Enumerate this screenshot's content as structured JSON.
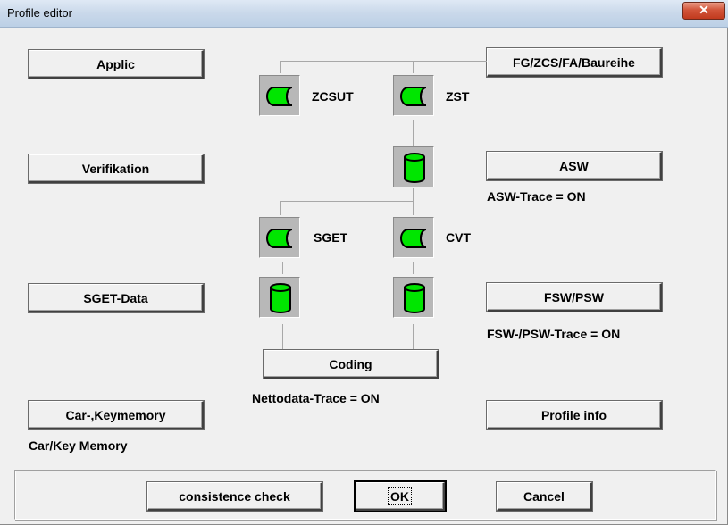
{
  "window": {
    "title": "Profile editor",
    "close_glyph": "✕"
  },
  "left_buttons": {
    "applic": "Applic",
    "verifikation": "Verifikation",
    "sget_data": "SGET-Data",
    "car_keymemory": "Car-,Keymemory"
  },
  "right_buttons": {
    "fg": "FG/ZCS/FA/Baureihe",
    "asw": "ASW",
    "fsw_psw": "FSW/PSW",
    "profile_info": "Profile info"
  },
  "center": {
    "coding": "Coding",
    "nodes": {
      "zcsut": "ZCSUT",
      "zst": "ZST",
      "sget": "SGET",
      "cvt": "CVT"
    }
  },
  "status": {
    "asw_trace": "ASW-Trace = ON",
    "fsw_psw_trace": "FSW-/PSW-Trace = ON",
    "nettodata_trace": "Nettodata-Trace = ON",
    "car_key_memory": "Car/Key Memory"
  },
  "footer": {
    "consistence_check": "consistence check",
    "ok": "OK",
    "cancel": "Cancel"
  },
  "icons": {
    "process_icon": "process-icon",
    "database_icon": "database-icon"
  },
  "colors": {
    "node_green": "#00e600",
    "node_bg": "#b8b8b8"
  }
}
